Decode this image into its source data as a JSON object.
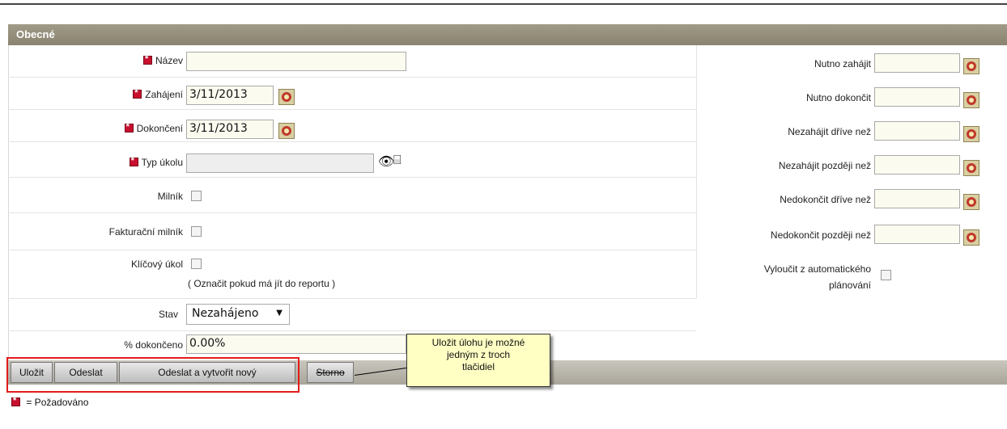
{
  "section_title": "Obecné",
  "left_fields": [
    {
      "label": "Název",
      "value": ""
    },
    {
      "label": "Zahájení",
      "value": "3/11/2013"
    },
    {
      "label": "Dokončení",
      "value": "3/11/2013"
    },
    {
      "label": "Typ úkolu",
      "value": ""
    },
    {
      "label": "Milník"
    },
    {
      "label": "Fakturační milník"
    },
    {
      "label": "Klíčový úkol",
      "hint": "( Označit pokud má jít do reportu )"
    },
    {
      "label": "Stav",
      "value": "Nezahájeno"
    },
    {
      "label": "% dokončeno",
      "value": "0.00%"
    }
  ],
  "right_fields": [
    {
      "label": "Nutno zahájit",
      "value": ""
    },
    {
      "label": "Nutno dokončit",
      "value": ""
    },
    {
      "label": "Nezahájit dříve než",
      "value": ""
    },
    {
      "label": "Nezahájit později než",
      "value": ""
    },
    {
      "label": "Nedokončit dříve než",
      "value": ""
    },
    {
      "label": "Nedokončit později než",
      "value": ""
    },
    {
      "label_line1": "Vyloučit z automatického",
      "label_line2": "plánování"
    }
  ],
  "buttons": {
    "save": "Uložit",
    "send": "Odeslat",
    "send_new": "Odeslat a vytvořit nový",
    "cancel": "Storno"
  },
  "callout": {
    "line1": "Uložit úlohu je možné",
    "line2": "jedným z troch",
    "line3": "tlačidiel"
  },
  "legend": "= Požadováno",
  "icons": {
    "required": "required-marker-icon",
    "calendar": "calendar-icon",
    "lookup": "binoculars-icon",
    "clear": "trash-icon"
  },
  "colors": {
    "header": "#8a8370",
    "required": "#c8102e",
    "highlight": "#e31b1b",
    "callout": "#ffffc4"
  }
}
